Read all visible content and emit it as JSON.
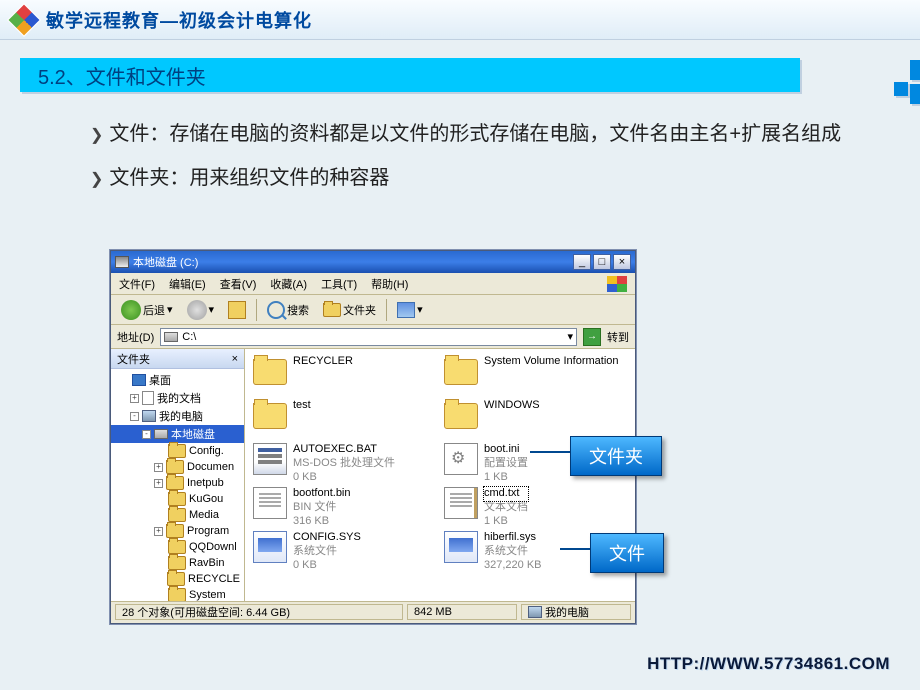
{
  "header": {
    "title": "敏学远程教育—初级会计电算化"
  },
  "section": {
    "title": "5.2、文件和文件夹"
  },
  "bullets": {
    "file": "文件：存储在电脑的资料都是以文件的形式存储在电脑，文件名由主名+扩展名组成",
    "folder": "文件夹：用来组织文件的种容器"
  },
  "window": {
    "title": "本地磁盘 (C:)",
    "menu": {
      "file": "文件(F)",
      "edit": "编辑(E)",
      "view": "查看(V)",
      "fav": "收藏(A)",
      "tools": "工具(T)",
      "help": "帮助(H)"
    },
    "toolbar": {
      "back": "后退",
      "search": "搜索",
      "folders": "文件夹"
    },
    "address": {
      "label": "地址(D)",
      "value": "C:\\",
      "go": "转到"
    },
    "treepane": {
      "title": "文件夹",
      "close": "×",
      "items": [
        {
          "indent": 0,
          "exp": "",
          "icon": "desk",
          "label": "桌面"
        },
        {
          "indent": 1,
          "exp": "+",
          "icon": "doc",
          "label": "我的文档"
        },
        {
          "indent": 1,
          "exp": "-",
          "icon": "pc",
          "label": "我的电脑"
        },
        {
          "indent": 2,
          "exp": "-",
          "icon": "disk",
          "label": "本地磁盘",
          "sel": true
        },
        {
          "indent": 3,
          "exp": "",
          "icon": "fld",
          "label": "Config."
        },
        {
          "indent": 3,
          "exp": "+",
          "icon": "fld",
          "label": "Documen"
        },
        {
          "indent": 3,
          "exp": "+",
          "icon": "fld",
          "label": "Inetpub"
        },
        {
          "indent": 3,
          "exp": "",
          "icon": "fld",
          "label": "KuGou"
        },
        {
          "indent": 3,
          "exp": "",
          "icon": "fld",
          "label": "Media"
        },
        {
          "indent": 3,
          "exp": "+",
          "icon": "fld",
          "label": "Program"
        },
        {
          "indent": 3,
          "exp": "",
          "icon": "fld",
          "label": "QQDownl"
        },
        {
          "indent": 3,
          "exp": "",
          "icon": "fld",
          "label": "RavBin"
        },
        {
          "indent": 3,
          "exp": "",
          "icon": "fld",
          "label": "RECYCLE"
        },
        {
          "indent": 3,
          "exp": "",
          "icon": "fld",
          "label": "System"
        }
      ]
    },
    "files": [
      {
        "icon": "folder",
        "name": "RECYCLER",
        "meta": ""
      },
      {
        "icon": "folder",
        "name": "System Volume Information",
        "meta": ""
      },
      {
        "icon": "folder",
        "name": "test",
        "meta": ""
      },
      {
        "icon": "folder",
        "name": "WINDOWS",
        "meta": ""
      },
      {
        "icon": "bat",
        "name": "AUTOEXEC.BAT",
        "meta": "MS-DOS 批处理文件\n0 KB"
      },
      {
        "icon": "ini",
        "name": "boot.ini",
        "meta": "配置设置\n1 KB"
      },
      {
        "icon": "txt",
        "name": "bootfont.bin",
        "meta": "BIN 文件\n316 KB"
      },
      {
        "icon": "txtring",
        "name": "cmd.txt",
        "meta": "文本文档\n1 KB",
        "sel": true
      },
      {
        "icon": "sys",
        "name": "CONFIG.SYS",
        "meta": "系统文件\n0 KB"
      },
      {
        "icon": "sys",
        "name": "hiberfil.sys",
        "meta": "系统文件\n327,220 KB"
      }
    ],
    "status": {
      "left": "28 个对象(可用磁盘空间: 6.44 GB)",
      "mid": "842 MB",
      "right": "我的电脑"
    }
  },
  "callouts": {
    "folder": "文件夹",
    "file": "文件"
  },
  "footer": {
    "url": "HTTP://WWW.57734861.COM"
  }
}
